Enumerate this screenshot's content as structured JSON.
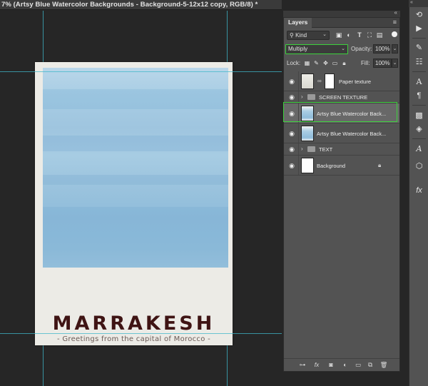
{
  "document": {
    "tab_title": "7% (Artsy Blue Watercolor Backgrounds - Background-5-12x12 copy, RGB/8) *"
  },
  "poster": {
    "title": "MARRAKESH",
    "subtitle": "- Greetings from the capital of Morocco -"
  },
  "layers_panel": {
    "tab_label": "Layers",
    "menu_icon": "panel-menu-icon",
    "filter": {
      "kind_label": "Kind",
      "icons": [
        "image-filter-icon",
        "adjustment-filter-icon",
        "type-filter-icon",
        "shape-filter-icon",
        "smart-object-filter-icon"
      ]
    },
    "blend_mode": "Multiply",
    "opacity_label": "Opacity:",
    "opacity_value": "100%",
    "lock_label": "Lock:",
    "fill_label": "Fill:",
    "fill_value": "100%",
    "layers": [
      {
        "name": "Paper texture",
        "type": "layer-with-mask",
        "visible": true,
        "selected": false
      },
      {
        "name": "SCREEN TEXTURE",
        "type": "group",
        "visible": true,
        "selected": false
      },
      {
        "name": "Artsy Blue Watercolor Back...",
        "type": "smart-object",
        "visible": true,
        "selected": true
      },
      {
        "name": "Artsy Blue Watercolor Back...",
        "type": "smart-object",
        "visible": true,
        "selected": false
      },
      {
        "name": "TEXT",
        "type": "group",
        "visible": true,
        "selected": false
      },
      {
        "name": "Background",
        "type": "background",
        "visible": true,
        "selected": false,
        "locked": true
      }
    ],
    "footer_icons": [
      "link-layers-icon",
      "fx-icon",
      "add-mask-icon",
      "adjustment-layer-icon",
      "new-group-icon",
      "new-layer-icon",
      "delete-layer-icon"
    ]
  },
  "toolbar": {
    "tools": [
      "history-icon",
      "play-icon",
      "brush-settings-icon",
      "adjustments-icon",
      "character-icon",
      "paragraph-icon",
      "swatches-icon",
      "styles-icon",
      "glyphs-icon",
      "3d-icon",
      "transform-icon"
    ]
  },
  "colors": {
    "highlight_green": "#3cd13c",
    "guide_cyan": "#3fb7c9",
    "title_color": "#3f1414",
    "panel_bg": "#535353"
  }
}
